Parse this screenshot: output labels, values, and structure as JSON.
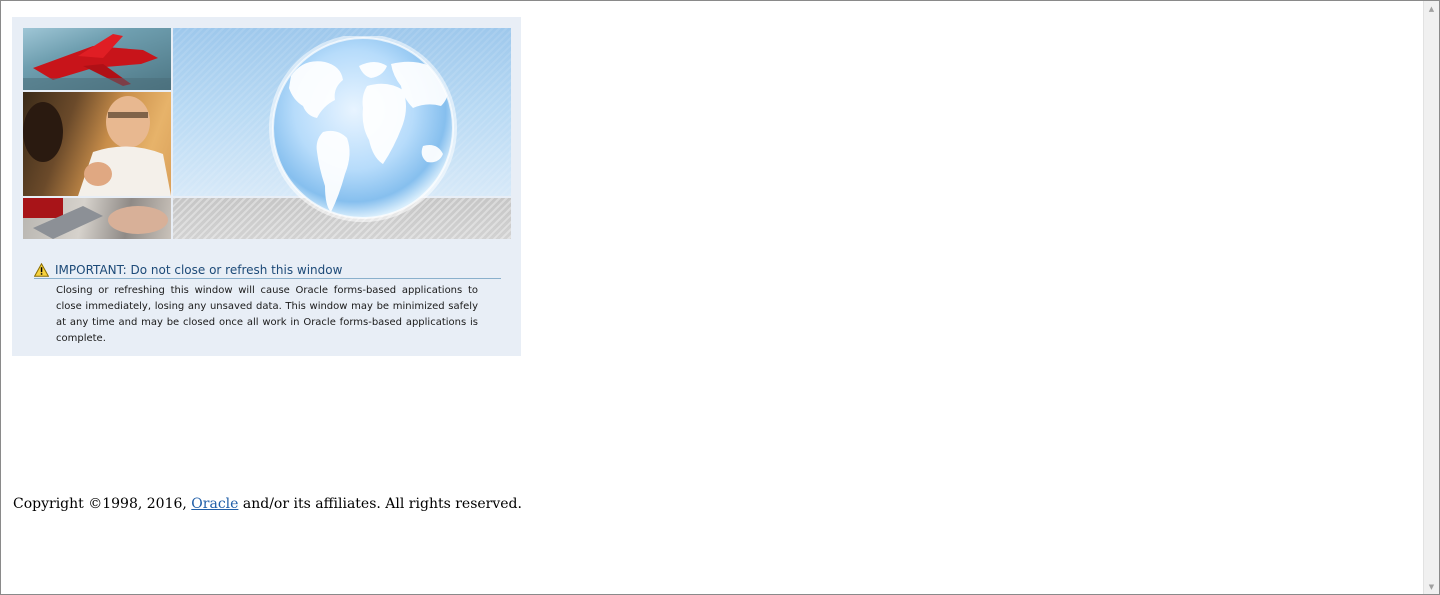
{
  "notice": {
    "icon": "warning-icon",
    "title": "IMPORTANT: Do not close or refresh this window",
    "body": "Closing or refreshing this window will cause Oracle forms-based applications to close immediately, losing any unsaved data. This window may be minimized safely at any time and may be closed once all work in Oracle forms-based applications is complete."
  },
  "footer": {
    "copyright_prefix": "Copyright ©1998, 2016, ",
    "link_text": "Oracle",
    "copyright_suffix": " and/or its affiliates. All rights reserved."
  },
  "colors": {
    "panel_background": "#e8eef6",
    "title_text": "#1d4a78",
    "link": "#1f5ea8"
  }
}
